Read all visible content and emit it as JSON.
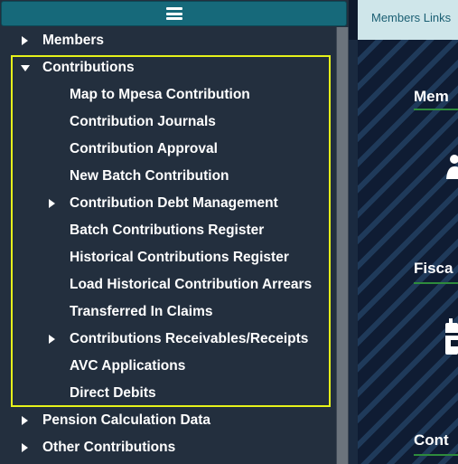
{
  "sidebar": {
    "toggle_icon": "hamburger-menu-icon",
    "items": [
      {
        "label": "Members",
        "expander": "right"
      },
      {
        "label": "Contributions",
        "expander": "down"
      },
      {
        "label": "Map to Mpesa Contribution",
        "expander": "none"
      },
      {
        "label": "Contribution Journals",
        "expander": "none"
      },
      {
        "label": "Contribution Approval",
        "expander": "none"
      },
      {
        "label": "New Batch Contribution",
        "expander": "none"
      },
      {
        "label": "Contribution Debt Management",
        "expander": "right"
      },
      {
        "label": "Batch Contributions Register",
        "expander": "none"
      },
      {
        "label": "Historical Contributions Register",
        "expander": "none"
      },
      {
        "label": "Load Historical Contribution Arrears",
        "expander": "none"
      },
      {
        "label": "Transferred In Claims",
        "expander": "none"
      },
      {
        "label": "Contributions Receivables/Receipts",
        "expander": "right"
      },
      {
        "label": "AVC Applications",
        "expander": "none"
      },
      {
        "label": "Direct Debits",
        "expander": "none"
      },
      {
        "label": "Pension Calculation Data",
        "expander": "right"
      },
      {
        "label": "Other Contributions",
        "expander": "right"
      }
    ]
  },
  "colors": {
    "sidebar_bg": "#232f3e",
    "toggle_bg": "#16697a",
    "highlight_border": "#e6f21a",
    "tab_bg": "#cfe6ea",
    "card_underline": "#2e8b3c"
  },
  "main": {
    "tab_label": "Members Links",
    "cards": [
      {
        "title": "Mem",
        "icon": "users-icon"
      },
      {
        "title": "Fisca",
        "icon": "calendar-icon"
      },
      {
        "title": "Cont",
        "icon": ""
      }
    ]
  }
}
